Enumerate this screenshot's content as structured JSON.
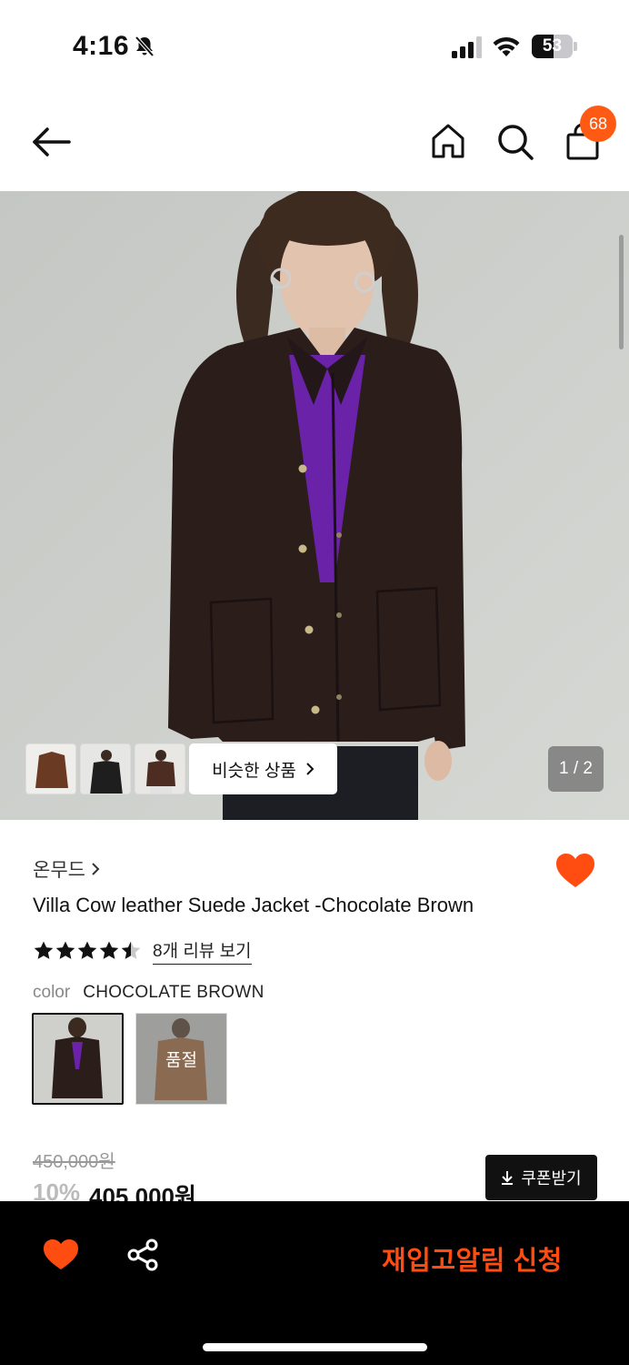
{
  "status_bar": {
    "time": "4:16",
    "battery_level": "53",
    "icons": [
      "bell-slash-icon",
      "signal-icon",
      "wifi-icon",
      "battery-icon"
    ]
  },
  "nav": {
    "icons": [
      "back-arrow-icon",
      "home-icon",
      "search-icon",
      "shopping-bag-icon"
    ],
    "cart_count": "68"
  },
  "gallery": {
    "similar_products_label": "비슷한 상품",
    "pager": "1 / 2",
    "thumbnails": 3
  },
  "product": {
    "brand": "온무드",
    "title": "Villa Cow leather Suede Jacket -Chocolate Brown",
    "rating_value": 4.5,
    "rating_max": 5,
    "review_link": "8개 리뷰 보기",
    "color_label": "color",
    "color_value": "CHOCOLATE BROWN",
    "sold_out_label": "품절",
    "original_price": "450,000원",
    "discount": "10%",
    "price": "405,000원",
    "coupon_label": "쿠폰받기"
  },
  "bottom_bar": {
    "restock_label": "재입고알림 신청"
  },
  "colors": {
    "accent": "#ff5a14",
    "restock": "#ff4d12",
    "bottom_bar_bg": "#000000"
  }
}
